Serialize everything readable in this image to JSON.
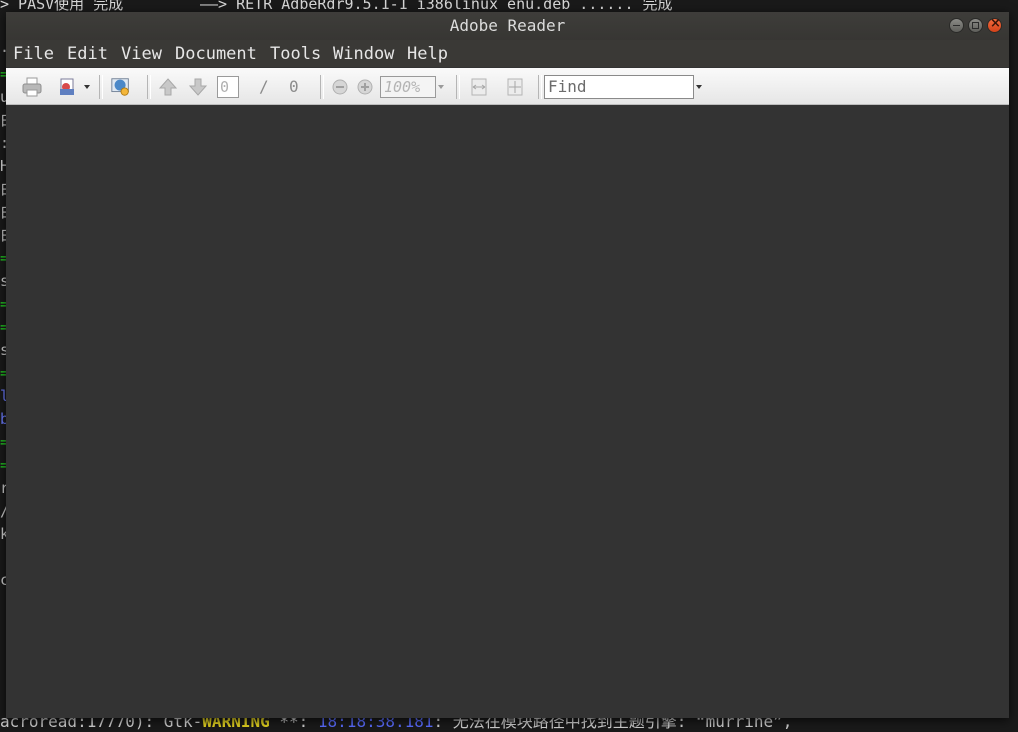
{
  "terminal": {
    "top_left_text": "> PASV使用 完成",
    "top_right_text": "——> RETR AdbeRdr9.5.1-1_i386linux_enu.deb ...... 完成",
    "bottom_line": {
      "prefix": "acroread:17770): Gtk-",
      "level": "WARNING",
      "sep": " **: ",
      "time": "18:18:38.181",
      "message": ": 无法在模块路径中找到主题引擎: “murrine”,"
    }
  },
  "window": {
    "title": "Adobe Reader"
  },
  "menu": {
    "items": [
      "File",
      "Edit",
      "View",
      "Document",
      "Tools",
      "Window",
      "Help"
    ]
  },
  "toolbar": {
    "page_current": "0",
    "page_separator": "/",
    "page_total": "0",
    "zoom": "100%",
    "find_placeholder": "Find"
  },
  "colors": {
    "document_background": "#333333",
    "toolbar_background": "#f0f0f0",
    "close_button": "#e4512a"
  },
  "icons": [
    "print-icon",
    "email-icon",
    "collaborate-icon",
    "prev-page-icon",
    "next-page-icon",
    "zoom-out-icon",
    "zoom-in-icon",
    "fit-width-icon",
    "fit-page-icon"
  ]
}
